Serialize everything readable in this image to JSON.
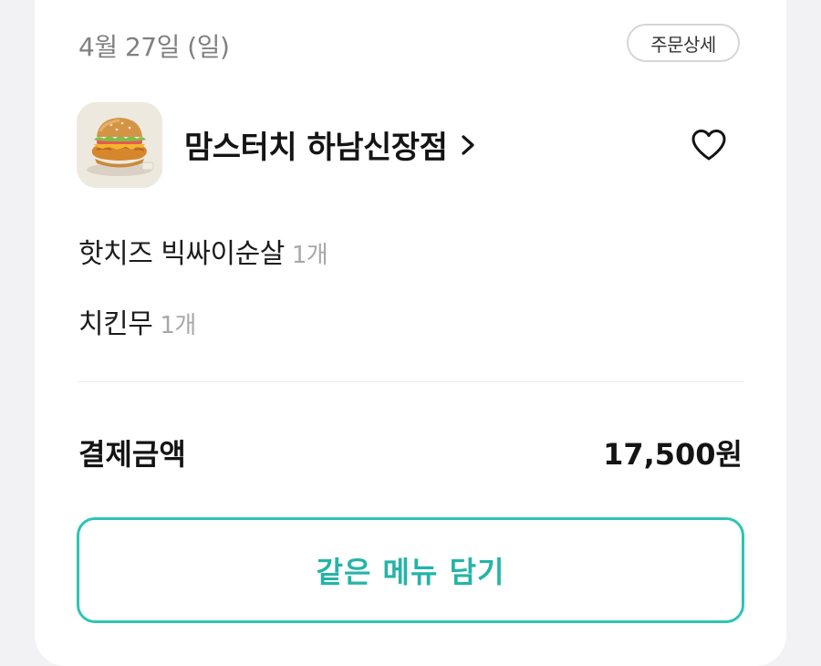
{
  "order": {
    "date": "4월 27일 (일)",
    "detail_label": "주문상세",
    "store_name": "맘스터치 하남신장점",
    "items": [
      {
        "name": "핫치즈 빅싸이순살",
        "qty": "1개"
      },
      {
        "name": "치킨무",
        "qty": "1개"
      }
    ],
    "payment_label": "결제금액",
    "payment_amount": "17,500원",
    "reorder_label": "같은 메뉴 담기"
  },
  "icons": {
    "store_thumbnail": "burger-image",
    "chevron": "chevron-right-icon",
    "favorite": "heart-outline-icon"
  },
  "colors": {
    "accent": "#2ec4b6",
    "text_primary": "#141414",
    "text_secondary": "#808080",
    "quantity": "#a8a8a8"
  }
}
